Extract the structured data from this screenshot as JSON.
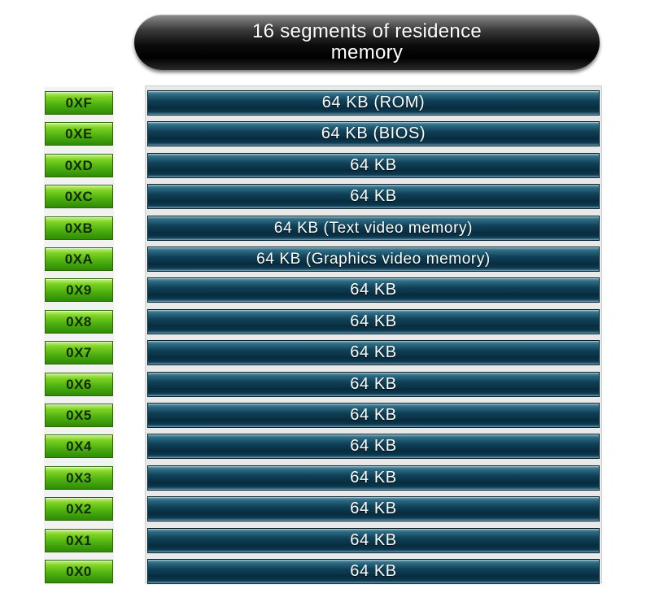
{
  "title": "16 segments of residence memory",
  "segments": [
    {
      "address": "0XF",
      "label": "64 KB (ROM)"
    },
    {
      "address": "0XE",
      "label": "64 KB (BIOS)"
    },
    {
      "address": "0XD",
      "label": "64 KB"
    },
    {
      "address": "0XC",
      "label": "64 KB"
    },
    {
      "address": "0XB",
      "label": "64 KB (Text video memory)"
    },
    {
      "address": "0XA",
      "label": "64 KB (Graphics video memory)"
    },
    {
      "address": "0X9",
      "label": "64 KB"
    },
    {
      "address": "0X8",
      "label": "64 KB"
    },
    {
      "address": "0X7",
      "label": "64 KB"
    },
    {
      "address": "0X6",
      "label": "64 KB"
    },
    {
      "address": "0X5",
      "label": "64 KB"
    },
    {
      "address": "0X4",
      "label": "64 KB"
    },
    {
      "address": "0X3",
      "label": "64 KB"
    },
    {
      "address": "0X2",
      "label": "64 KB"
    },
    {
      "address": "0X1",
      "label": "64 KB"
    },
    {
      "address": "0X0",
      "label": "64 KB"
    }
  ],
  "colors": {
    "address_fill": "#4caf10",
    "segment_fill": "#0f4158",
    "title_fill": "#0c0c0c",
    "text": "#ffffff"
  }
}
